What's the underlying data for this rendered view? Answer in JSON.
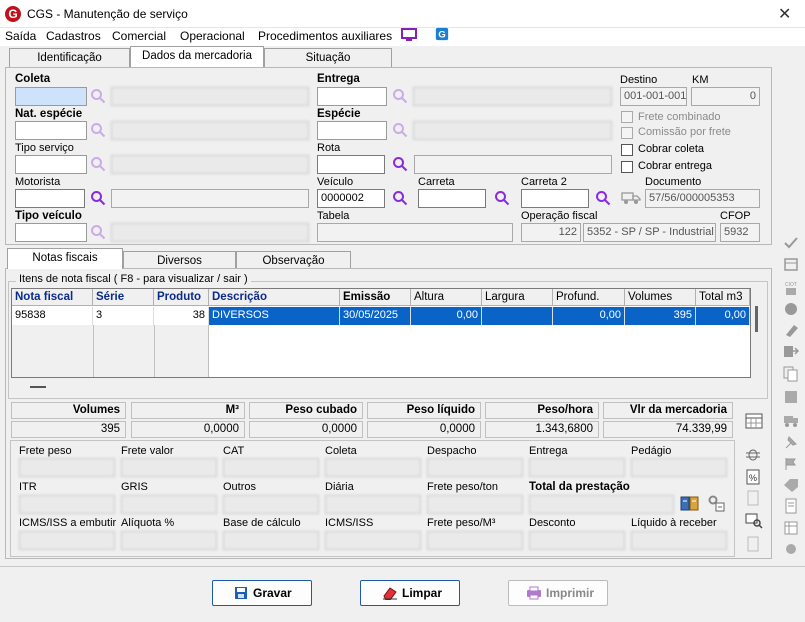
{
  "window": {
    "title": "CGS - Manutenção de serviço",
    "close": "✕"
  },
  "menu": [
    "Saída",
    "Cadastros",
    "Comercial",
    "Operacional",
    "Procedimentos auxiliares"
  ],
  "tabs": [
    "Identificação",
    "Dados da mercadoria",
    "Situação"
  ],
  "form": {
    "coleta": "Coleta",
    "entrega": "Entrega",
    "destino_label": "Destino",
    "destino_value": "001-001-001",
    "km_label": "KM",
    "km_value": "0",
    "nat_especie": "Nat. espécie",
    "especie": "Espécie",
    "frete_combinado": "Frete combinado",
    "comissao_frete": "Comissão por frete",
    "tipo_servico": "Tipo serviço",
    "rota": "Rota",
    "cobrar_coleta": "Cobrar coleta",
    "cobrar_entrega": "Cobrar entrega",
    "motorista": "Motorista",
    "veiculo": "Veículo",
    "veiculo_value": "0000002",
    "carreta": "Carreta",
    "carreta2": "Carreta 2",
    "documento": "Documento",
    "documento_value": "57/56/000005353",
    "tipo_veiculo": "Tipo veículo",
    "tabela": "Tabela",
    "operacao_fiscal": "Operação fiscal",
    "operacao_code": "122",
    "operacao_desc": "5352 - SP / SP - Industrial -",
    "cfop_label": "CFOP",
    "cfop_value": "5932"
  },
  "subtabs": [
    "Notas fiscais",
    "Diversos",
    "Observação"
  ],
  "notas": {
    "group_title": "Itens de nota fiscal ( F8 - para visualizar / sair )",
    "columns": [
      "Nota fiscal",
      "Série",
      "Produto",
      "Descrição",
      "Emissão",
      "Altura",
      "Largura",
      "Profund.",
      "Volumes",
      "Total m3"
    ],
    "rows": [
      [
        "95838",
        "3",
        "38",
        "DIVERSOS",
        "30/05/2025",
        "0,00",
        "",
        "0,00",
        "395",
        "0,00"
      ]
    ]
  },
  "totals": {
    "headers": [
      "Volumes",
      "M³",
      "Peso cubado",
      "Peso líquido",
      "Peso/hora",
      "Vlr da mercadoria"
    ],
    "values": [
      "395",
      "0,0000",
      "0,0000",
      "0,0000",
      "1.343,6800",
      "74.339,99"
    ]
  },
  "prestacao": {
    "row1": [
      "Frete peso",
      "Frete valor",
      "CAT",
      "Coleta",
      "Despacho",
      "Entrega",
      "Pedágio"
    ],
    "row2": [
      "ITR",
      "GRIS",
      "Outros",
      "Diária",
      "Frete peso/ton",
      "Total da prestação"
    ],
    "row3": [
      "ICMS/ISS a embutir",
      "Alíquota %",
      "Base de cálculo",
      "ICMS/ISS",
      "Frete peso/M³",
      "Desconto",
      "Líquido à receber"
    ]
  },
  "buttons": {
    "gravar": "Gravar",
    "limpar": "Limpar",
    "imprimir": "Imprimir"
  },
  "colors": {
    "accent": "#0a64c8",
    "brand": "#c0121d",
    "magnifier": "#8a2be2"
  }
}
